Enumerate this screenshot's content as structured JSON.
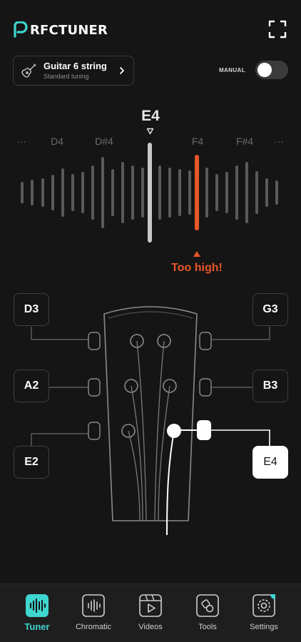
{
  "app": {
    "logo_text_accent": "P",
    "logo_text": "RFCTUNER"
  },
  "instrument": {
    "name": "Guitar 6 string",
    "tuning": "Standard tuning",
    "icon": "guitar-icon"
  },
  "manual": {
    "label": "MANUAL",
    "enabled": false
  },
  "meter": {
    "current_note": "E4",
    "notes": [
      "···",
      "D4",
      "D#4",
      "",
      "F4",
      "F#4",
      "···"
    ],
    "status": "Too high!",
    "colors": {
      "accent": "#e8562a",
      "center": "#c9c9c9",
      "bar": "#5a5a5a"
    }
  },
  "strings": [
    {
      "label": "D3",
      "active": false
    },
    {
      "label": "G3",
      "active": false
    },
    {
      "label": "A2",
      "active": false
    },
    {
      "label": "B3",
      "active": false
    },
    {
      "label": "E2",
      "active": false
    },
    {
      "label": "E4",
      "active": true
    }
  ],
  "nav": {
    "items": [
      {
        "label": "Tuner",
        "icon": "tuner-icon",
        "active": true
      },
      {
        "label": "Chromatic",
        "icon": "chromatic-icon",
        "active": false
      },
      {
        "label": "Videos",
        "icon": "videos-icon",
        "active": false
      },
      {
        "label": "Tools",
        "icon": "tools-icon",
        "active": false
      },
      {
        "label": "Settings",
        "icon": "settings-icon",
        "active": false,
        "badge": true
      }
    ],
    "accent": "#3fd6cf"
  }
}
